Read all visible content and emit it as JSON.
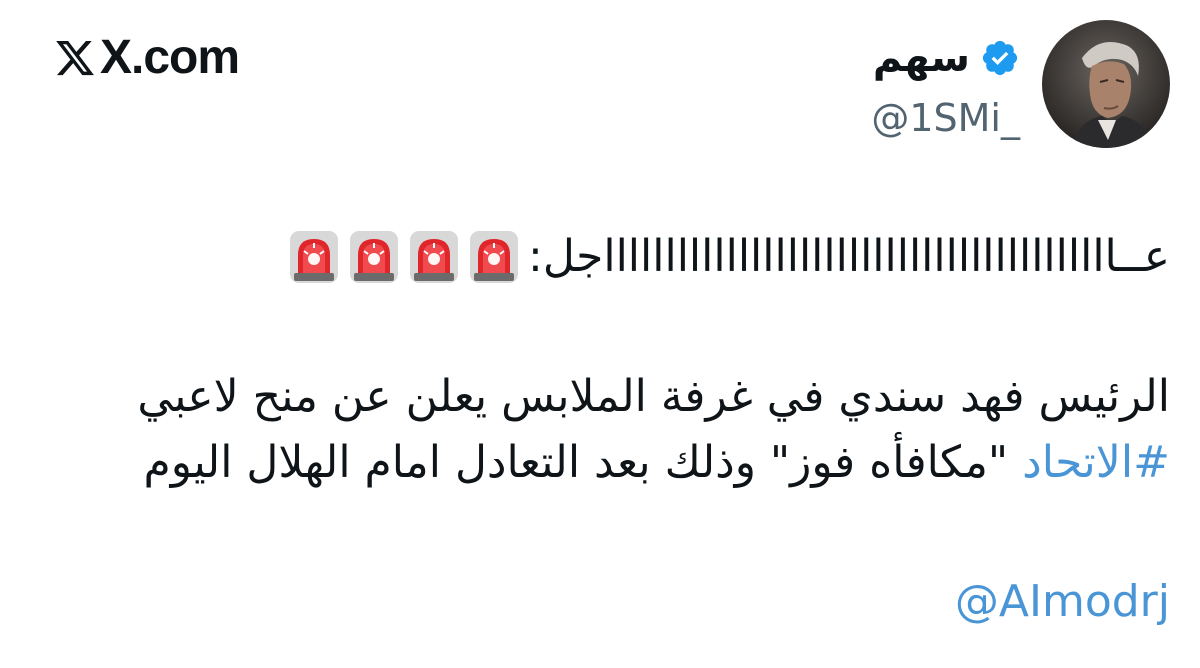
{
  "brand": {
    "label": "X.com",
    "icon": "x-logo-icon"
  },
  "author": {
    "display_name": "سهم",
    "handle": "@1SMi_",
    "verified": true,
    "verified_icon": "verified-badge-icon",
    "avatar": "avatar",
    "verified_color": "#1d9bf0"
  },
  "tweet": {
    "line1_text": "عــااااااااااااااااااااااااااااااااااااااااااجل:",
    "line1_emoji": [
      "siren-icon",
      "siren-icon",
      "siren-icon",
      "siren-icon"
    ],
    "para1_text": "الرئيس فهد سندي في غرفة الملابس يعلن عن منح لاعبي",
    "para2_hashtag": "#الاتحاد",
    "para2_text": " \"مكافأه فوز\" وذلك بعد التعادل امام الهلال اليوم",
    "mention": "@AImodrj",
    "link_color": "#4a95d6"
  }
}
